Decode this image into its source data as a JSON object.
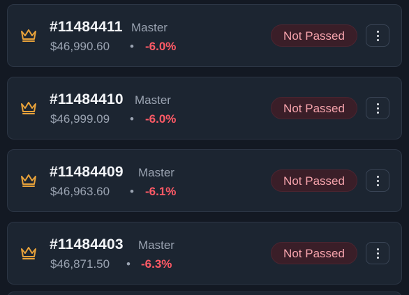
{
  "colors": {
    "background": "#131923",
    "card": "#1c2531",
    "crown": "#e8a23a",
    "negative": "#ff5a66",
    "badge_bg": "#3a1e28",
    "badge_text": "#f6a3ac"
  },
  "accounts": [
    {
      "icon": "crown-icon",
      "id": "#11484411",
      "tier": "Master",
      "balance": "$46,990.60",
      "separator": "•",
      "change": "-6.0%",
      "status": "Not Passed",
      "menu_icon": "more-vertical-icon"
    },
    {
      "icon": "crown-icon",
      "id": "#11484410",
      "tier": "Master",
      "balance": "$46,999.09",
      "separator": "•",
      "change": "-6.0%",
      "status": "Not Passed",
      "menu_icon": "more-vertical-icon"
    },
    {
      "icon": "crown-icon",
      "id": "#11484409",
      "tier": "Master",
      "balance": "$46,963.60",
      "separator": "•",
      "change": "-6.1%",
      "status": "Not Passed",
      "menu_icon": "more-vertical-icon"
    },
    {
      "icon": "crown-icon",
      "id": "#11484403",
      "tier": "Master",
      "balance": "$46,871.50",
      "separator": "•",
      "change": "-6.3%",
      "status": "Not Passed",
      "menu_icon": "more-vertical-icon"
    }
  ]
}
